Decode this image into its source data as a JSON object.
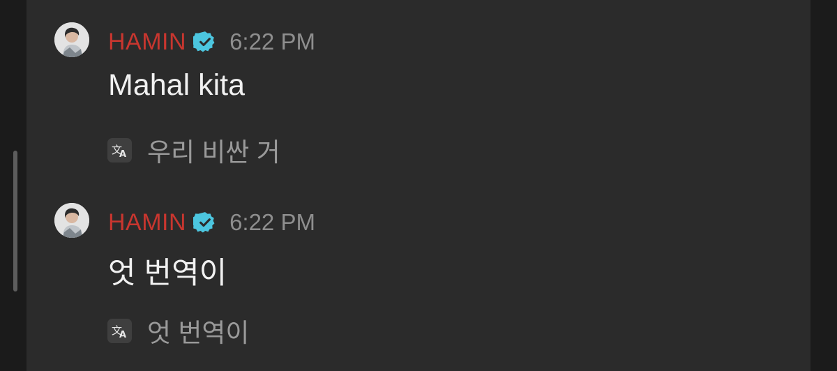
{
  "colors": {
    "username": "#c8362f",
    "verified_badge": "#4cc6df",
    "background": "#2b2b2b"
  },
  "messages": [
    {
      "author": "HAMIN",
      "verified_icon": "verified-badge-icon",
      "time": "6:22 PM",
      "text": "Mahal kita",
      "translate_icon": "translate-icon",
      "translation": "우리 비싼 거"
    },
    {
      "author": "HAMIN",
      "verified_icon": "verified-badge-icon",
      "time": "6:22 PM",
      "text": "엇 번역이",
      "translate_icon": "translate-icon",
      "translation": "엇 번역이"
    }
  ]
}
